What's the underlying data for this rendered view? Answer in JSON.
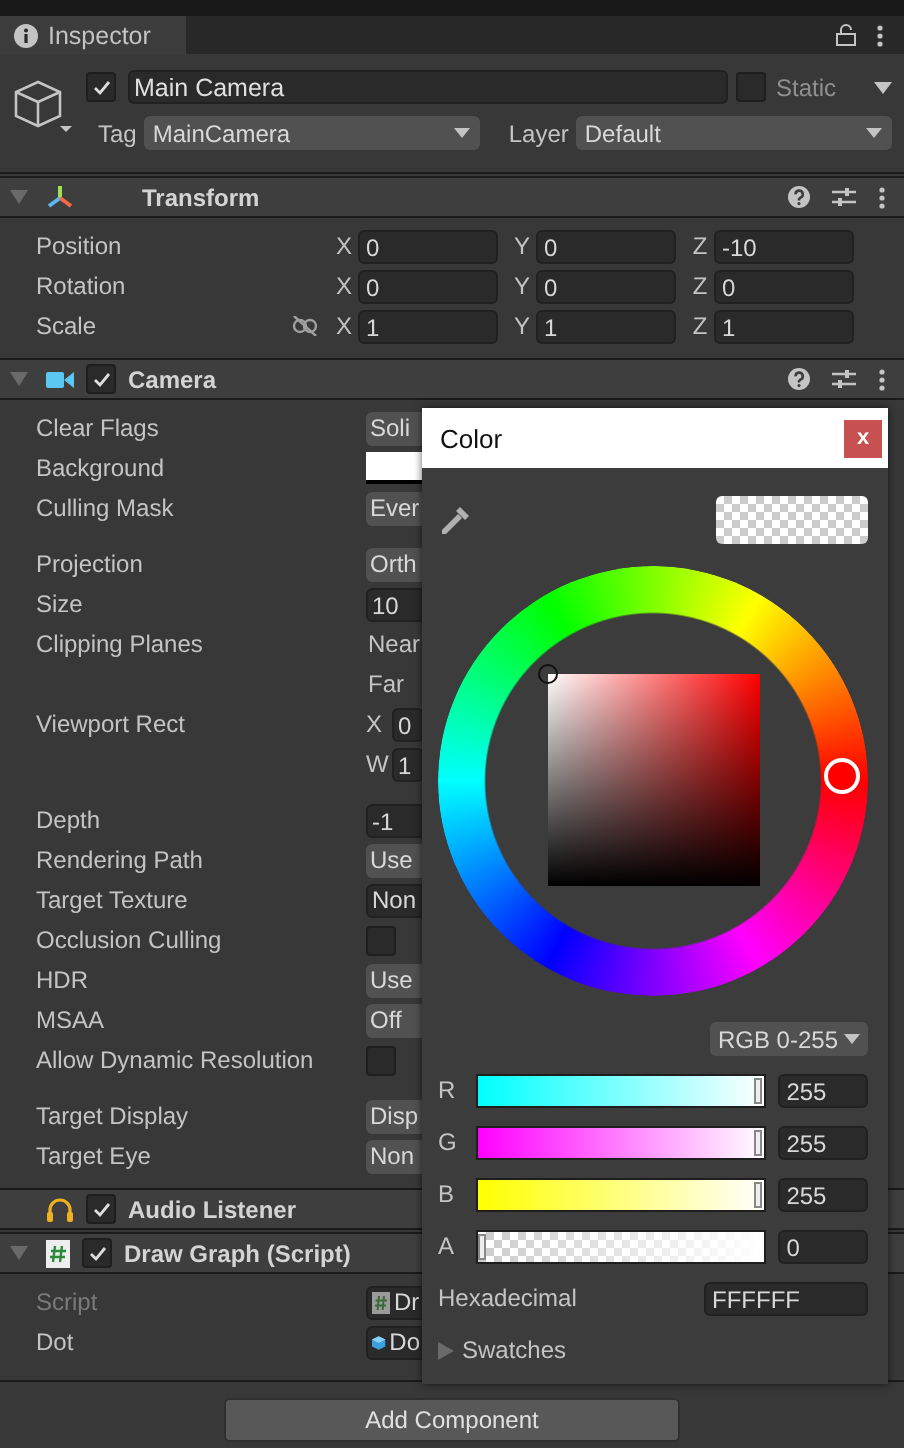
{
  "tab": {
    "title": "Inspector"
  },
  "object": {
    "active": true,
    "name": "Main Camera",
    "static_label": "Static",
    "static": false,
    "tag_label": "Tag",
    "tag": "MainCamera",
    "layer_label": "Layer",
    "layer": "Default"
  },
  "components": [
    {
      "kind": "transform",
      "title": "Transform",
      "expanded": true,
      "groups": [
        [
          {
            "label": "Position",
            "kind": "vector",
            "fields": [
              {
                "axis": "X",
                "value": "0"
              },
              {
                "axis": "Y",
                "value": "0"
              },
              {
                "axis": "Z",
                "value": "-10"
              }
            ]
          },
          {
            "label": "Rotation",
            "kind": "vector",
            "fields": [
              {
                "axis": "X",
                "value": "0"
              },
              {
                "axis": "Y",
                "value": "0"
              },
              {
                "axis": "Z",
                "value": "0"
              }
            ]
          },
          {
            "label": "Scale",
            "kind": "vector",
            "constrained": false,
            "fields": [
              {
                "axis": "X",
                "value": "1"
              },
              {
                "axis": "Y",
                "value": "1"
              },
              {
                "axis": "Z",
                "value": "1"
              }
            ]
          }
        ]
      ]
    },
    {
      "kind": "camera",
      "title": "Camera",
      "enabled": true,
      "expanded": true,
      "groups": [
        [
          {
            "label": "Clear Flags",
            "kind": "dropdown",
            "value": "Soli"
          },
          {
            "label": "Background",
            "kind": "color",
            "color": "#ffffff"
          },
          {
            "label": "Culling Mask",
            "kind": "dropdown",
            "value": "Ever"
          }
        ],
        [
          {
            "label": "Projection",
            "kind": "dropdown",
            "value": "Orth"
          },
          {
            "label": "Size",
            "kind": "field",
            "value": "10"
          },
          {
            "label": "Clipping Planes",
            "kind": "text",
            "value": "Near"
          },
          {
            "kind": "text",
            "value": "Far"
          },
          {
            "label": "Viewport Rect",
            "kind": "axis",
            "axis": "X",
            "value": "0"
          },
          {
            "kind": "axis",
            "axis": "W",
            "value": "1"
          }
        ],
        [
          {
            "label": "Depth",
            "kind": "field",
            "value": "-1"
          },
          {
            "label": "Rendering Path",
            "kind": "dropdown",
            "value": "Use"
          },
          {
            "label": "Target Texture",
            "kind": "object",
            "value": "Non"
          },
          {
            "label": "Occlusion Culling",
            "kind": "checkbox",
            "checked": false
          },
          {
            "label": "HDR",
            "kind": "dropdown",
            "value": "Use"
          },
          {
            "label": "MSAA",
            "kind": "dropdown",
            "value": "Off"
          },
          {
            "label": "Allow Dynamic Resolution",
            "kind": "checkbox",
            "checked": false
          }
        ],
        [
          {
            "label": "Target Display",
            "kind": "dropdown",
            "value": "Disp"
          },
          {
            "label": "Target Eye",
            "kind": "dropdown",
            "value": "Non"
          }
        ]
      ]
    },
    {
      "kind": "audio",
      "title": "Audio Listener",
      "enabled": true
    },
    {
      "kind": "script",
      "title": "Draw Graph (Script)",
      "enabled": true,
      "expanded": true,
      "groups": [
        [
          {
            "label": "Script",
            "kind": "script",
            "value": "Dr",
            "disabled": true
          },
          {
            "label": "Dot",
            "kind": "asset",
            "value": "Do",
            "disabled": false
          }
        ]
      ]
    }
  ],
  "add_component": "Add Component",
  "color_picker": {
    "title": "Color",
    "close": "x",
    "mode": "RGB 0-255",
    "channels": [
      {
        "name": "R",
        "value": "255",
        "level": 1
      },
      {
        "name": "G",
        "value": "255",
        "level": 1
      },
      {
        "name": "B",
        "value": "255",
        "level": 1
      },
      {
        "name": "A",
        "value": "0",
        "level": 0
      }
    ],
    "hex_label": "Hexadecimal",
    "hex": "FFFFFF",
    "swatches": {
      "label": "Swatches",
      "expanded": false
    }
  }
}
